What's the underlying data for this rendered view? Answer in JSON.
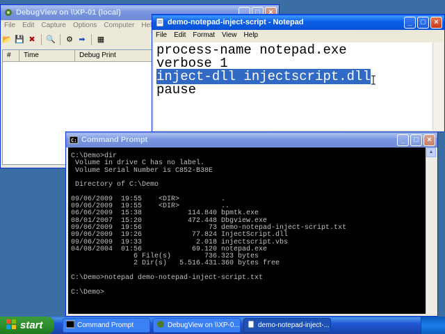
{
  "debugview": {
    "title": "DebugView on \\\\XP-01 (local)",
    "menu": [
      "File",
      "Edit",
      "Capture",
      "Options",
      "Computer",
      "Help"
    ],
    "columns": [
      "#",
      "Time",
      "Debug Print"
    ]
  },
  "notepad": {
    "title": "demo-notepad-inject-script - Notepad",
    "menu": [
      "File",
      "Edit",
      "Format",
      "View",
      "Help"
    ],
    "lines": [
      "process-name notepad.exe",
      "verbose 1",
      "inject-dll injectscript.dll",
      "pause"
    ],
    "selected_line_index": 2
  },
  "cmd": {
    "title": "Command Prompt",
    "lines": [
      "C:\\Demo>dir",
      " Volume in drive C has no label.",
      " Volume Serial Number is C852-B38E",
      "",
      " Directory of C:\\Demo",
      "",
      "09/06/2009  19:55    <DIR>          .",
      "09/06/2009  19:55    <DIR>          ..",
      "06/06/2009  15:38           114.840 bpmtk.exe",
      "08/01/2007  15:20           472.448 Dbgview.exe",
      "09/06/2009  19:56                73 demo-notepad-inject-script.txt",
      "09/06/2009  19:26            77.824 InjectScript.dll",
      "09/06/2009  19:33             2.018 injectscript.vbs",
      "04/08/2004  01:56            69.120 notepad.exe",
      "               6 File(s)        736.323 bytes",
      "               2 Dir(s)   5.516.431.360 bytes free",
      "",
      "C:\\Demo>notepad demo-notepad-inject-script.txt",
      "",
      "C:\\Demo>"
    ]
  },
  "taskbar": {
    "start_label": "start",
    "tasks": [
      "Command Prompt",
      "DebugView on \\\\XP-0...",
      "demo-notepad-inject-..."
    ]
  },
  "colors": {
    "desktop": "#3a6ea5",
    "titlebar_active": "#0a5fe8",
    "selection": "#316ac5",
    "console_bg": "#000000",
    "console_text": "#c0c0c0",
    "start_button": "#2f8f2f"
  }
}
